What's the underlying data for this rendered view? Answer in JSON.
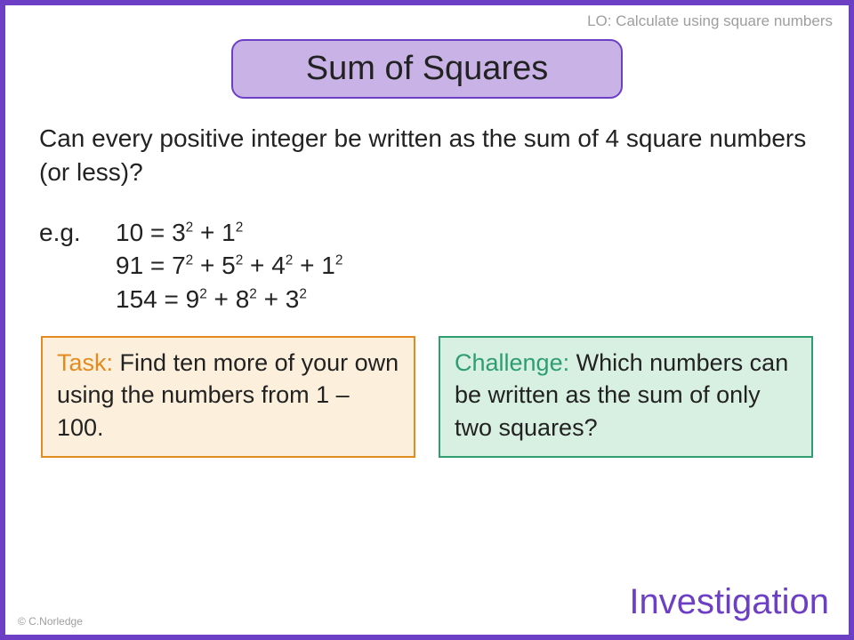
{
  "lo": "LO: Calculate using square numbers",
  "title": "Sum of Squares",
  "question": "Can every positive integer be written as the sum of 4 square numbers (or less)?",
  "eg_label": "e.g.",
  "examples": [
    {
      "lhs": "10",
      "terms": [
        "3",
        "1"
      ]
    },
    {
      "lhs": "91",
      "terms": [
        "7",
        "5",
        "4",
        "1"
      ]
    },
    {
      "lhs": "154",
      "terms": [
        "9",
        "8",
        "3"
      ]
    }
  ],
  "task": {
    "title": "Task:",
    "body": "Find ten more of your own using the numbers from 1 – 100."
  },
  "challenge": {
    "title": "Challenge:",
    "body": "Which numbers can be written as the sum of only two squares?"
  },
  "footer": "Investigation",
  "copyright": "© C.Norledge"
}
